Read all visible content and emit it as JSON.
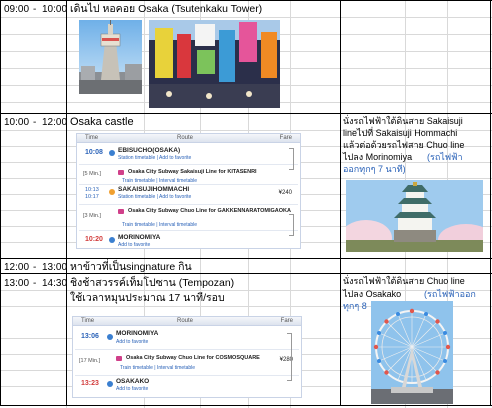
{
  "rows": [
    {
      "start": "09:00",
      "dash": "-",
      "end": "10:00",
      "activity": "เดินไป   หอคอย   Osaka (Tsutenkaku Tower)"
    },
    {
      "start": "10:00",
      "dash": "-",
      "end": "12:00",
      "activity": "Osaka castle",
      "note_lines": [
        "นั่งรถไฟฟ้าใต้ดินสาย   Sakaisuji",
        "lineไปที่   Sakaisuji Hommachi",
        "แล้วต่อด้วยรถไฟสาย   Chuo line",
        "ไปลง    Morinomiya"
      ],
      "note_link_1": "(รถไฟฟ้า",
      "note_link_2": "ออกทุกๆ     7 นาที)"
    },
    {
      "start": "12:00",
      "dash": "-",
      "end": "13:00",
      "activity": "หาข้าวที่เป็นsingnature กิน"
    },
    {
      "start": "13:00",
      "dash": "-",
      "end": "14:30",
      "activity_line_1": "ชิงช้าสวรรค์เท็มโปซาน   (Tempozan)",
      "activity_line_2": "ใช้เวลาหมุนประมาณ   17 นาที/รอบ",
      "note_lines": [
        "นั่งรถไฟฟ้าใต้ดินสาย    Chuo line",
        "ไปลง    Osakako"
      ],
      "note_link_1": "(รถไฟฟ้าออก",
      "note_link_2": "ทุกๆ    8"
    }
  ],
  "route1": {
    "head_time": "Time",
    "head_route": "Route",
    "head_fare": "Fare",
    "stops": [
      {
        "time": "10:08",
        "station": "EBISUCHO(OSAKA)",
        "link": "Station timetable | Add to favorite"
      },
      {
        "time": "10:13",
        "time2": "10:17",
        "station": "SAKAISUJIHOMMACHI",
        "link": "Station timetable | Add to favorite"
      },
      {
        "time": "10:20",
        "station": "MORINOMIYA",
        "link": "Add to favorite"
      }
    ],
    "legs": [
      {
        "min": "[5 Min.]",
        "line": "Osaka City Subway Sakaisuji Line  for KITASENRI",
        "link": "Train timetable | Interval timetable"
      },
      {
        "min": "[3 Min.]",
        "line": "Osaka City Subway Chuo Line  for GAKKENNARATOMIGAOKA",
        "link": "Train timetable | Interval timetable"
      }
    ],
    "transfer": "[1 Min.]",
    "fare": "¥240"
  },
  "route2": {
    "head_time": "Time",
    "head_route": "Route",
    "head_fare": "Fare",
    "stops": [
      {
        "time": "13:06",
        "station": "MORINOMIYA",
        "link": "Add to favorite"
      },
      {
        "time": "13:23",
        "station": "OSAKAKO",
        "link": "Add to favorite"
      }
    ],
    "leg": {
      "min": "[17 Min.]",
      "line": "Osaka City Subway Chuo Line  for COSMOSQUARE",
      "link": "Train timetable | Interval timetable"
    },
    "fare": "¥280"
  },
  "colors": {
    "link_blue": "#2a62b8",
    "arrival_red": "#d23c3c",
    "route_border": "#c9d3e6",
    "sky_blue": "#8fc3ec"
  },
  "images": [
    {
      "icon": "tsutenkaku-tower-photo"
    },
    {
      "icon": "dotonbori-signs-photo"
    },
    {
      "icon": "osaka-castle-photo"
    },
    {
      "icon": "tempozan-ferris-wheel-photo"
    }
  ]
}
